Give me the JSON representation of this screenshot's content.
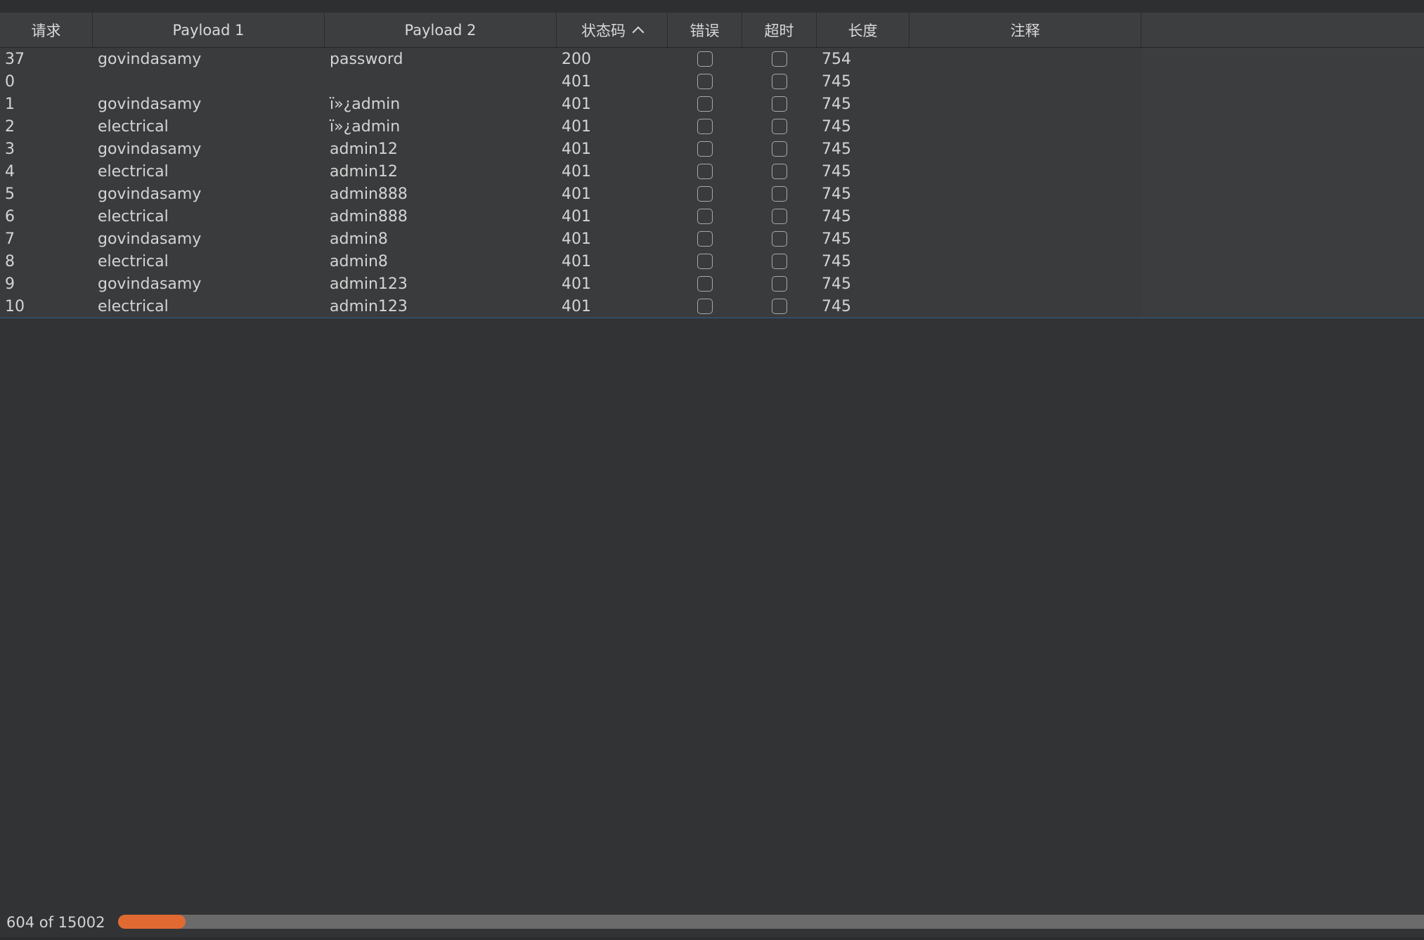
{
  "table": {
    "columns": [
      {
        "key": "request",
        "label": "请求"
      },
      {
        "key": "payload1",
        "label": "Payload 1"
      },
      {
        "key": "payload2",
        "label": "Payload 2"
      },
      {
        "key": "status",
        "label": "状态码"
      },
      {
        "key": "error",
        "label": "错误"
      },
      {
        "key": "timeout",
        "label": "超时"
      },
      {
        "key": "length",
        "label": "长度"
      },
      {
        "key": "comment",
        "label": "注释"
      }
    ],
    "sorted_column": "status",
    "sort_direction": "ascending",
    "rows": [
      {
        "request": "37",
        "payload1": "govindasamy",
        "payload2": "password",
        "status": "200",
        "error": false,
        "timeout": false,
        "length": "754",
        "comment": ""
      },
      {
        "request": "0",
        "payload1": "",
        "payload2": "",
        "status": "401",
        "error": false,
        "timeout": false,
        "length": "745",
        "comment": ""
      },
      {
        "request": "1",
        "payload1": "govindasamy",
        "payload2": "ï»¿admin",
        "status": "401",
        "error": false,
        "timeout": false,
        "length": "745",
        "comment": ""
      },
      {
        "request": "2",
        "payload1": "electrical",
        "payload2": "ï»¿admin",
        "status": "401",
        "error": false,
        "timeout": false,
        "length": "745",
        "comment": ""
      },
      {
        "request": "3",
        "payload1": "govindasamy",
        "payload2": "admin12",
        "status": "401",
        "error": false,
        "timeout": false,
        "length": "745",
        "comment": ""
      },
      {
        "request": "4",
        "payload1": "electrical",
        "payload2": "admin12",
        "status": "401",
        "error": false,
        "timeout": false,
        "length": "745",
        "comment": ""
      },
      {
        "request": "5",
        "payload1": "govindasamy",
        "payload2": "admin888",
        "status": "401",
        "error": false,
        "timeout": false,
        "length": "745",
        "comment": ""
      },
      {
        "request": "6",
        "payload1": "electrical",
        "payload2": "admin888",
        "status": "401",
        "error": false,
        "timeout": false,
        "length": "745",
        "comment": ""
      },
      {
        "request": "7",
        "payload1": "govindasamy",
        "payload2": "admin8",
        "status": "401",
        "error": false,
        "timeout": false,
        "length": "745",
        "comment": ""
      },
      {
        "request": "8",
        "payload1": "electrical",
        "payload2": "admin8",
        "status": "401",
        "error": false,
        "timeout": false,
        "length": "745",
        "comment": ""
      },
      {
        "request": "9",
        "payload1": "govindasamy",
        "payload2": "admin123",
        "status": "401",
        "error": false,
        "timeout": false,
        "length": "745",
        "comment": ""
      },
      {
        "request": "10",
        "payload1": "electrical",
        "payload2": "admin123",
        "status": "401",
        "error": false,
        "timeout": false,
        "length": "745",
        "comment": ""
      }
    ]
  },
  "progress": {
    "label": "604 of 15002",
    "completed": 604,
    "total": 15002
  },
  "colors": {
    "background": "#323335",
    "table_background": "#3a3b3d",
    "header_background": "#3d3e40",
    "accent_line": "#2b5f8a",
    "progress_fill": "#e06a32",
    "progress_track": "#6b6b6b",
    "text": "#d4d4d4"
  }
}
